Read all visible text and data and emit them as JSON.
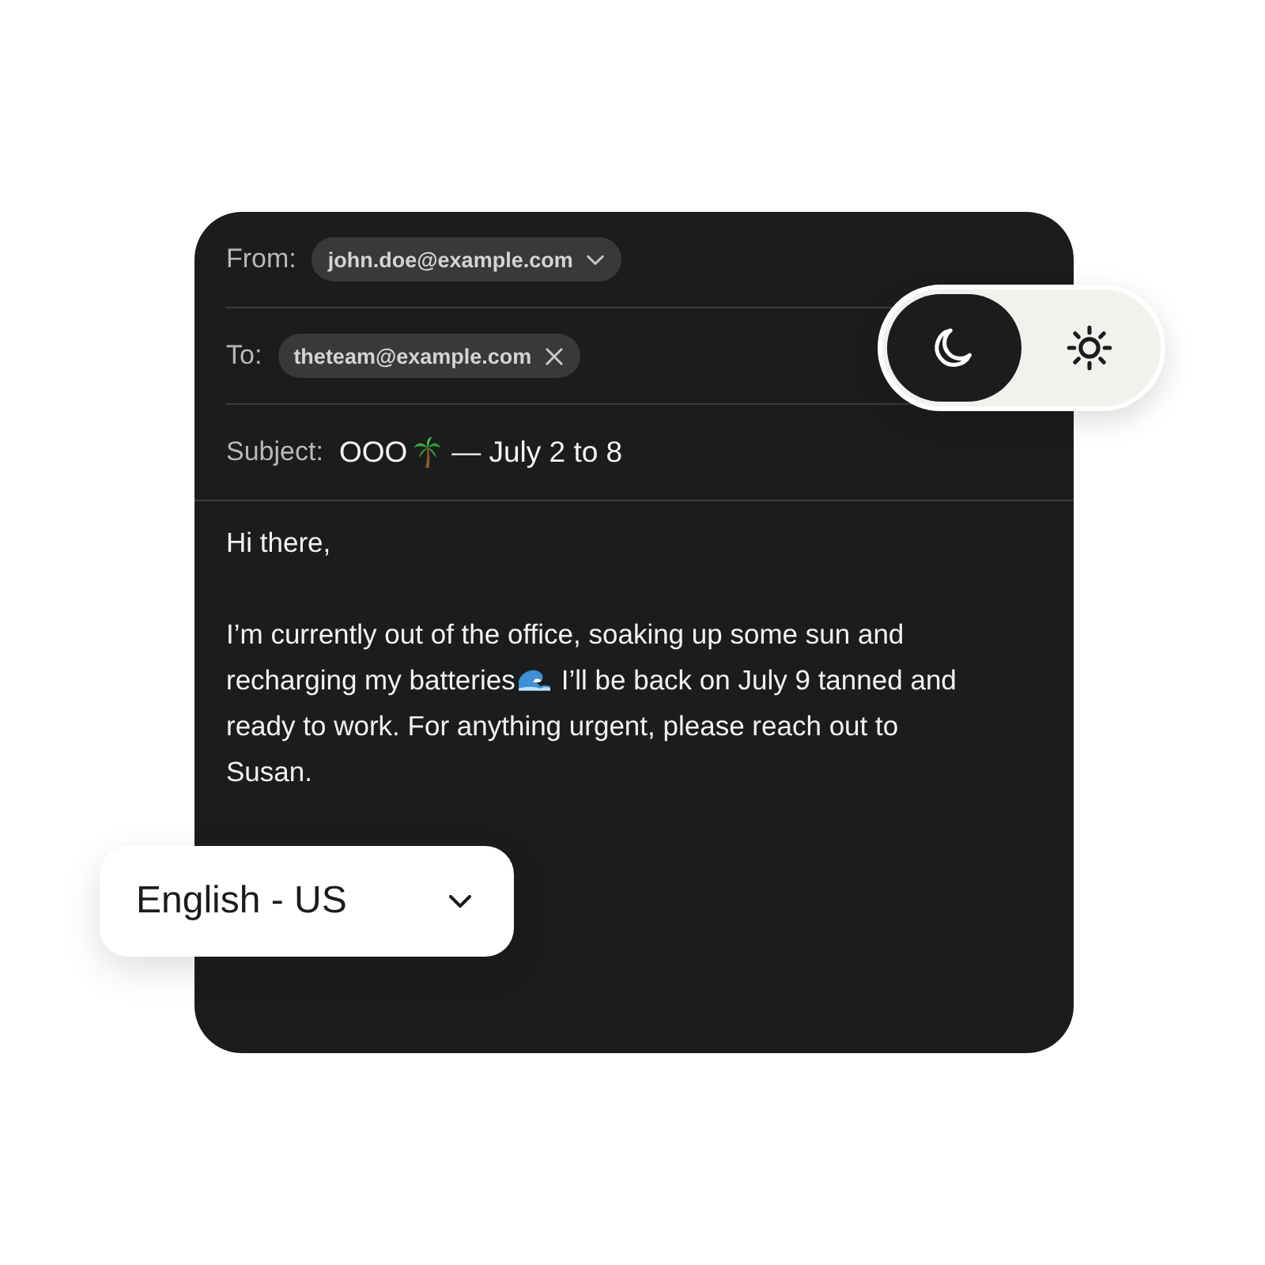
{
  "compose": {
    "from": {
      "label": "From:",
      "address": "john.doe@example.com"
    },
    "to": {
      "label": "To:",
      "recipients": [
        {
          "address": "theteam@example.com"
        }
      ]
    },
    "subject": {
      "label": "Subject:",
      "before": "OOO",
      "after": "— July 2 to 8"
    },
    "body": {
      "greeting": "Hi there,",
      "paragraph_before": "I’m currently out of the office, soaking up some sun and recharging my batteries",
      "paragraph_after": "I’ll be back on July 9 tanned and ready to work. For anything urgent, please reach out to Susan."
    }
  },
  "theme_toggle": {
    "options": [
      {
        "kind": "dark",
        "selected": true
      },
      {
        "kind": "light",
        "selected": false
      }
    ]
  },
  "language_select": {
    "value": "English - US"
  }
}
